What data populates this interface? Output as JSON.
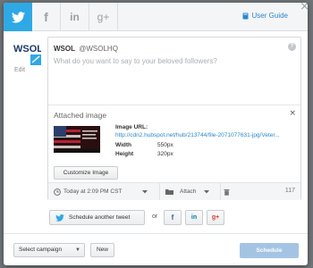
{
  "tabs": [
    {
      "icon": "twitter-icon",
      "active": true
    },
    {
      "icon": "facebook-icon",
      "active": false
    },
    {
      "icon": "linkedin-icon",
      "active": false
    },
    {
      "icon": "google-plus-icon",
      "active": false
    }
  ],
  "header": {
    "user_guide_label": "User Guide",
    "close_glyph": "×"
  },
  "account": {
    "logo_text": "WSOL",
    "name": "WSOL",
    "handle": "@WSOLHQ",
    "edit_label": "Edit",
    "help_glyph": "?"
  },
  "composer": {
    "placeholder": "What do you want to say to your beloved followers?"
  },
  "attachment": {
    "title": "Attached image",
    "close_glyph": "×",
    "url_label": "Image URL:",
    "url_value": "http://cdn2.hubspot.net/hub/213744/file-2071077631-jpg/Veter...",
    "width_label": "Width",
    "width_value": "550px",
    "height_label": "Height",
    "height_value": "320px",
    "customize_label": "Customize Image"
  },
  "toolbar": {
    "time_label": "Today at 2:09 PM CST",
    "attach_label": "Attach",
    "char_count": "117"
  },
  "actions": {
    "another_tweet_label": "Schedule another tweet",
    "or_label": "or",
    "facebook_glyph": "f",
    "linkedin_glyph": "in",
    "google_glyph": "g+"
  },
  "footer": {
    "campaign_label": "Select campaign",
    "new_label": "New",
    "schedule_label": "Schedule"
  },
  "colors": {
    "accent": "#2fa8e6",
    "link": "#2a87d0",
    "schedule_disabled": "#a5c4e4",
    "google_red": "#d73d32",
    "facebook_blue": "#3b5998",
    "linkedin_blue": "#0077b5"
  }
}
